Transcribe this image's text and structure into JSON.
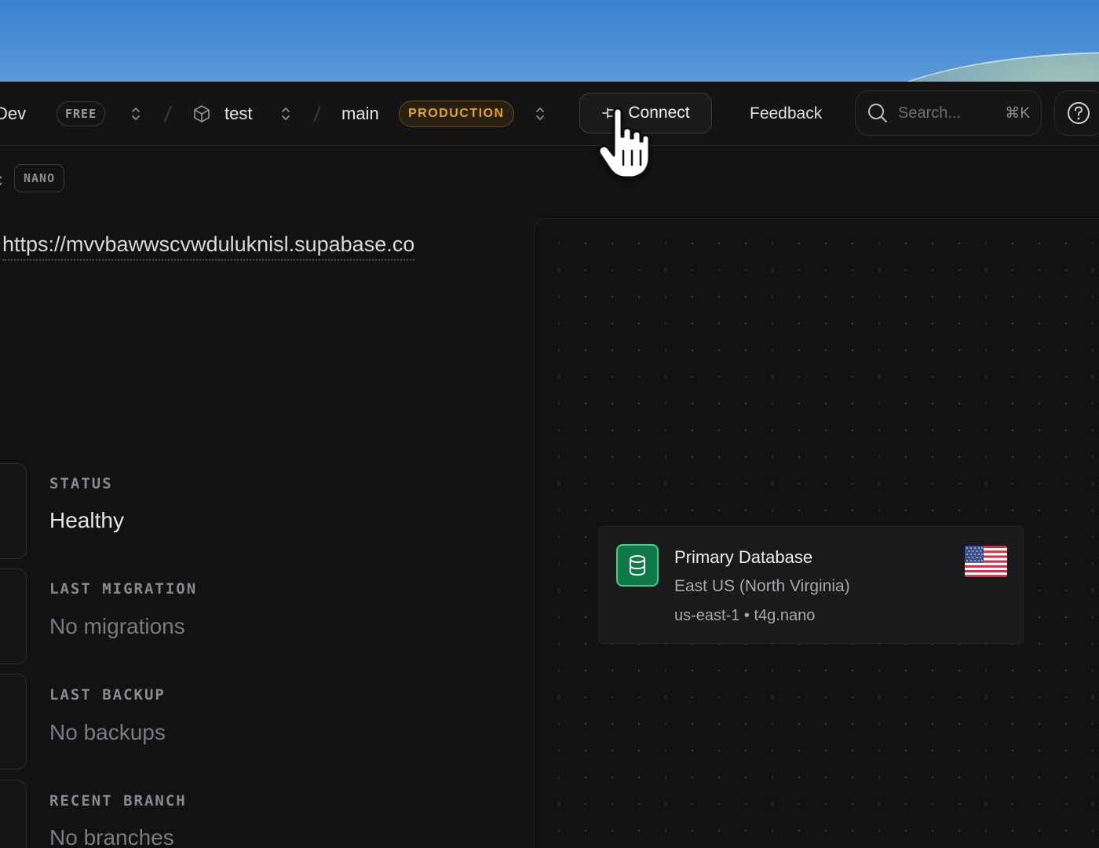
{
  "header": {
    "org_name": "Dev",
    "plan_badge": "FREE",
    "project_name": "test",
    "branch_name": "main",
    "branch_badge": "PRODUCTION",
    "connect_label": "Connect",
    "feedback_label": "Feedback",
    "search_placeholder": "Search...",
    "search_shortcut": "⌘K"
  },
  "project": {
    "compute_badge": "NANO",
    "url": "https://mvvbawwscvwduluknisl.supabase.co"
  },
  "stats": [
    {
      "label": "STATUS",
      "value": "Healthy"
    },
    {
      "label": "LAST MIGRATION",
      "value": "No migrations"
    },
    {
      "label": "LAST BACKUP",
      "value": "No backups"
    },
    {
      "label": "RECENT BRANCH",
      "value": "No branches"
    }
  ],
  "database_card": {
    "title": "Primary Database",
    "region": "East US (North Virginia)",
    "meta": "us-east-1 • t4g.nano"
  },
  "colors": {
    "brand_green": "#3ecf8e",
    "production_amber": "#e3a52a",
    "background": "#121214"
  }
}
